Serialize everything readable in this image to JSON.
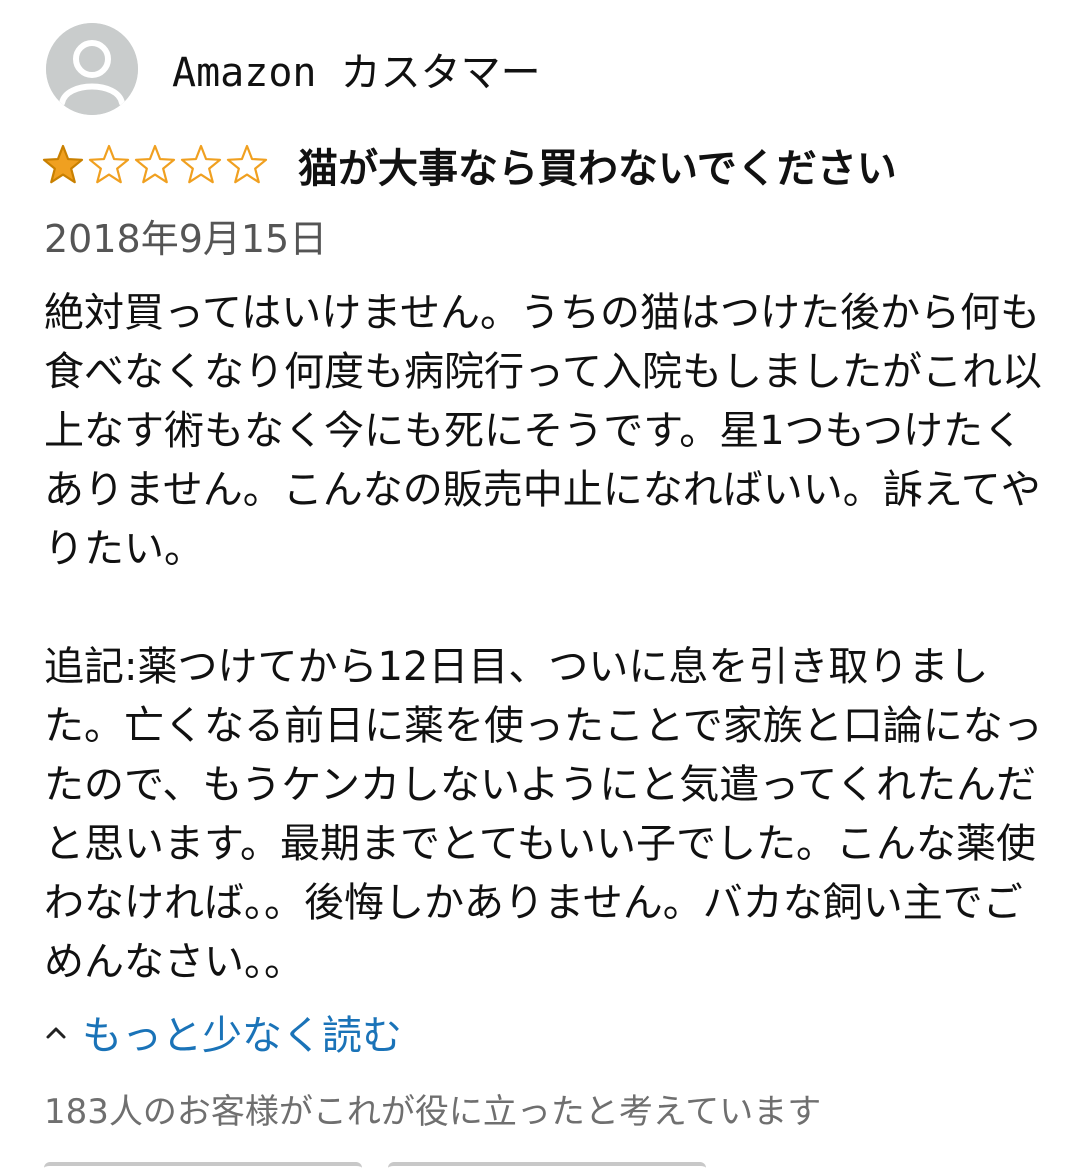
{
  "reviewer": {
    "name": "Amazon カスタマー",
    "avatar_icon": "user-silhouette-icon"
  },
  "rating": {
    "value": 1,
    "max": 5,
    "filled_color": "#f0a020",
    "empty_color": "#f0a020"
  },
  "review": {
    "title": "猫が大事なら買わないでください",
    "date": "2018年9月15日",
    "paragraphs": [
      "絶対買ってはいけません。うちの猫はつけた後から何も食べなくなり何度も病院行って入院もしましたがこれ以上なす術もなく今にも死にそうです。星1つもつけたくありません。こんなの販売中止になればいい。訴えてやりたい。",
      "追記:薬つけてから12日目、ついに息を引き取りました。亡くなる前日に薬を使ったことで家族と口論になったので、もうケンカしないようにと気遣ってくれたんだと思います。最期までとてもいい子でした。こんな薬使わなければ。。後悔しかありません。バカな飼い主でごめんなさい。。"
    ],
    "read_less_label": "もっと少なく読む",
    "read_less_icon": "chevron-up-icon",
    "helpful_text": "183人のお客様がこれが役に立ったと考えています"
  },
  "colors": {
    "link": "#1a73b8",
    "muted": "#6f6f6f"
  }
}
